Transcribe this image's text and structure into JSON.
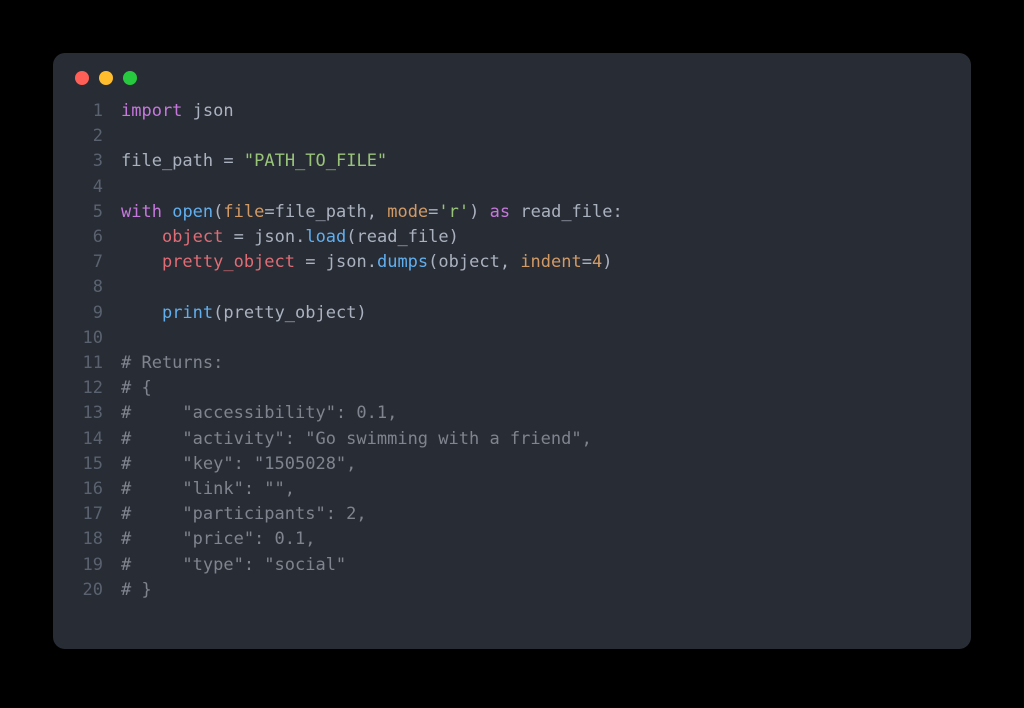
{
  "window": {
    "traffic_lights": [
      "red",
      "yellow",
      "green"
    ]
  },
  "code": {
    "line_count": 20,
    "lines": {
      "1": {
        "ln": "1",
        "kw_import": "import",
        "sp": " ",
        "mod_json": "json"
      },
      "2": {
        "ln": "2"
      },
      "3": {
        "ln": "3",
        "var_fp": "file_path",
        "sp1": " ",
        "eq": "=",
        "sp2": " ",
        "str_path": "\"PATH_TO_FILE\""
      },
      "4": {
        "ln": "4"
      },
      "5": {
        "ln": "5",
        "kw_with": "with",
        "sp1": " ",
        "fn_open": "open",
        "lp": "(",
        "arg_file": "file",
        "eq1": "=",
        "var_fp": "file_path",
        "comma1": ", ",
        "arg_mode": "mode",
        "eq2": "=",
        "str_r": "'r'",
        "rp": ")",
        "sp2": " ",
        "kw_as": "as",
        "sp3": " ",
        "var_rf": "read_file",
        "colon": ":"
      },
      "6": {
        "ln": "6",
        "indent": "    ",
        "var_obj": "object",
        "sp1": " ",
        "eq": "=",
        "sp2": " ",
        "mod_json": "json",
        "dot": ".",
        "fn_load": "load",
        "lp": "(",
        "var_rf": "read_file",
        "rp": ")"
      },
      "7": {
        "ln": "7",
        "indent": "    ",
        "var_po": "pretty_object",
        "sp1": " ",
        "eq": "=",
        "sp2": " ",
        "mod_json": "json",
        "dot": ".",
        "fn_dumps": "dumps",
        "lp": "(",
        "var_obj": "object",
        "comma": ", ",
        "arg_indent": "indent",
        "eq2": "=",
        "num_4": "4",
        "rp": ")"
      },
      "8": {
        "ln": "8"
      },
      "9": {
        "ln": "9",
        "indent": "    ",
        "fn_print": "print",
        "lp": "(",
        "var_po": "pretty_object",
        "rp": ")"
      },
      "10": {
        "ln": "10"
      },
      "11": {
        "ln": "11",
        "cm": "# Returns:"
      },
      "12": {
        "ln": "12",
        "cm": "# {"
      },
      "13": {
        "ln": "13",
        "cm": "#     \"accessibility\": 0.1,"
      },
      "14": {
        "ln": "14",
        "cm": "#     \"activity\": \"Go swimming with a friend\","
      },
      "15": {
        "ln": "15",
        "cm": "#     \"key\": \"1505028\","
      },
      "16": {
        "ln": "16",
        "cm": "#     \"link\": \"\","
      },
      "17": {
        "ln": "17",
        "cm": "#     \"participants\": 2,"
      },
      "18": {
        "ln": "18",
        "cm": "#     \"price\": 0.1,"
      },
      "19": {
        "ln": "19",
        "cm": "#     \"type\": \"social\""
      },
      "20": {
        "ln": "20",
        "cm": "# }"
      }
    }
  }
}
